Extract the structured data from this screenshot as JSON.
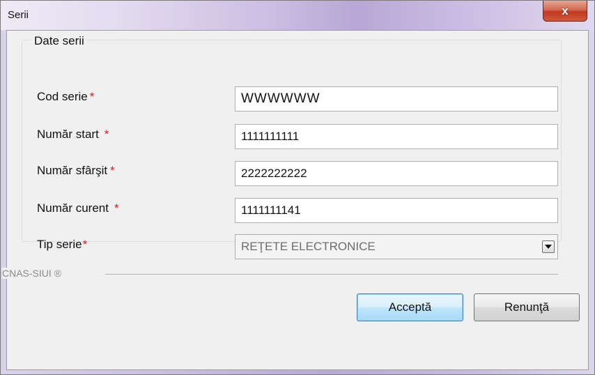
{
  "window": {
    "title": "Serii",
    "close_label": "x"
  },
  "group": {
    "title": "Date serii"
  },
  "fields": {
    "cod_serie": {
      "label": "Cod serie",
      "value": "WWWWWW"
    },
    "numar_start": {
      "label": "Număr start",
      "value": "1111111111"
    },
    "numar_sfarsit": {
      "label": "Număr sfârşit",
      "value": "2222222222"
    },
    "numar_curent": {
      "label": "Număr curent",
      "value": "1111111141"
    },
    "tip_serie": {
      "label": "Tip serie",
      "value": "REŢETE ELECTRONICE"
    }
  },
  "required_mark": "*",
  "footer": {
    "label": "CNAS-SIUI ®"
  },
  "buttons": {
    "accept": "Acceptă",
    "cancel": "Renunţă"
  },
  "icons": {
    "close": "close-icon",
    "dropdown": "chevron-down-icon"
  }
}
